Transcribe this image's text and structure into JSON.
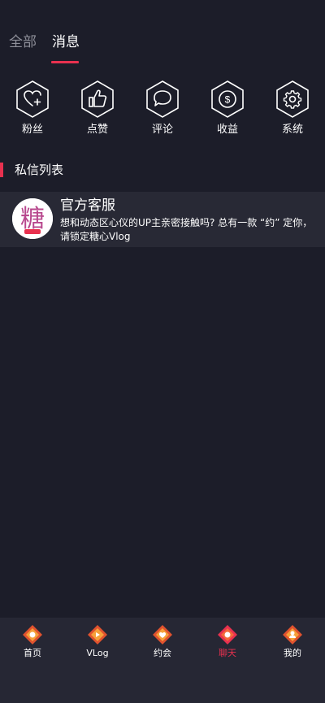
{
  "tabs": {
    "all": "全部",
    "messages": "消息"
  },
  "quick_actions": [
    {
      "label": "粉丝",
      "icon": "heart-plus-icon"
    },
    {
      "label": "点赞",
      "icon": "thumbs-up-icon"
    },
    {
      "label": "评论",
      "icon": "comment-icon"
    },
    {
      "label": "收益",
      "icon": "dollar-icon"
    },
    {
      "label": "系统",
      "icon": "gear-icon"
    }
  ],
  "section": {
    "title": "私信列表"
  },
  "messages": [
    {
      "name": "官方客服",
      "preview": "想和动态区心仪的UP主亲密接触吗? 总有一款 “约” 定你，请锁定糖心Vlog",
      "avatar_text": "糖"
    }
  ],
  "bottom_nav": [
    {
      "label": "首页",
      "active": false
    },
    {
      "label": "VLog",
      "active": false
    },
    {
      "label": "约会",
      "active": false
    },
    {
      "label": "聊天",
      "active": true
    },
    {
      "label": "我的",
      "active": false
    }
  ],
  "colors": {
    "background": "#1c1d29",
    "accent": "#e8314f",
    "nav_background": "#262734"
  }
}
